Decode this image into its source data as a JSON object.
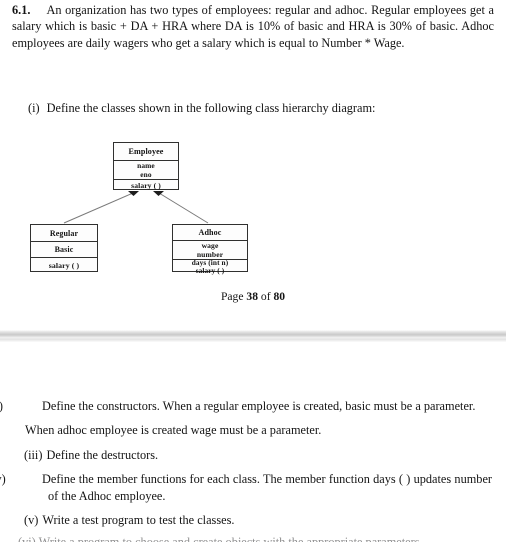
{
  "document": {
    "question_number": "6.1.",
    "intro_text": "An organization has two types of employees: regular and adhoc. Regular employees     get a salary which is basic + DA + HRA where DA is 10% of basic and HRA is 30% of basic. Adhoc employees are daily wagers who get a salary which is equal to Number * Wage.",
    "page_footer": {
      "prefix": "Page",
      "current": "38",
      "middle": "of",
      "total": "80"
    }
  },
  "items": {
    "i": {
      "label": "(i)",
      "text": "Define the classes shown in the following class hierarchy diagram:"
    },
    "ii": {
      "label": "(ii)",
      "text": "Define the constructors. When a regular employee is created, basic must be a parameter."
    },
    "ii_extra": {
      "text": "When adhoc employee is created wage must be a parameter."
    },
    "iii": {
      "label": "(iii)",
      "text": "Define the destructors."
    },
    "iv": {
      "label": "(iv)",
      "text": "Define the member functions for each class. The member function days ( ) updates number of the Adhoc employee."
    },
    "v": {
      "label": "(v)",
      "text": "Write a test program to test the classes."
    },
    "vi_clipped": {
      "text": "(vi) Write a program to choose and create objects with the appropriate parameters"
    }
  },
  "diagram": {
    "title": "class-hierarchy-diagram",
    "classes": {
      "employee": {
        "name": "Employee",
        "attributes": [
          "name",
          "eno"
        ],
        "methods": [
          "salary ( )"
        ]
      },
      "regular": {
        "name": "Regular",
        "attributes": [
          "Basic"
        ],
        "methods": [
          "salary ( )"
        ]
      },
      "adhoc": {
        "name": "Adhoc",
        "attributes": [
          "wage",
          "number"
        ],
        "methods": [
          "days (int n)",
          "salary ( )"
        ]
      }
    },
    "relations": [
      {
        "from": "regular",
        "to": "employee",
        "type": "inheritance"
      },
      {
        "from": "adhoc",
        "to": "employee",
        "type": "inheritance"
      }
    ]
  },
  "colors": {
    "text": "#141414",
    "box_border": "#30302f",
    "separator": "#c9c9c9",
    "page_background": "#ffffff"
  }
}
